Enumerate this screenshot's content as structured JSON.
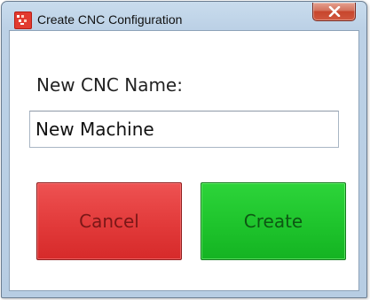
{
  "window": {
    "title": "Create CNC Configuration",
    "icon": "app-icon",
    "close_icon": "close-icon"
  },
  "form": {
    "name_label": "New CNC Name:",
    "name_value": "New Machine"
  },
  "buttons": {
    "cancel_label": "Cancel",
    "create_label": "Create"
  },
  "colors": {
    "cancel": "#e23a3a",
    "create": "#1ec42c",
    "close": "#c7452c"
  }
}
